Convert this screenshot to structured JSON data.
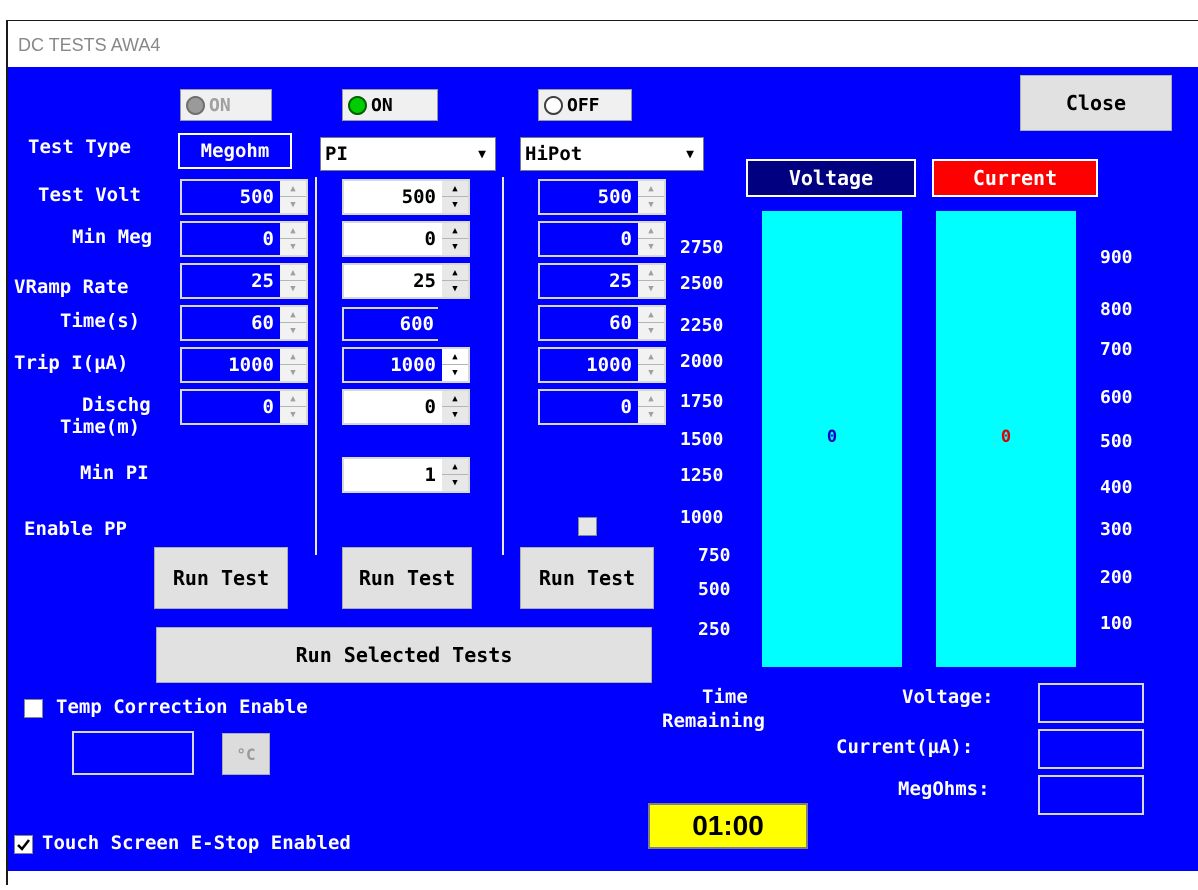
{
  "window": {
    "title": "DC TESTS  AWA4"
  },
  "colors": {
    "background": "#0000ff",
    "bar": "#00ffff",
    "on_led": "#00cc00",
    "current_header": "#ff0000",
    "voltage_header": "#000080",
    "timer_bg": "#ffff00"
  },
  "close_label": "Close",
  "row_labels": {
    "test_type": "Test Type",
    "test_volt": "Test Volt",
    "min_meg": "Min Meg",
    "vramp_rate": "VRamp Rate",
    "time_s": "Time(s)",
    "trip_i": "Trip I(µA)",
    "dischg_line1": "Dischg",
    "dischg_line2": "Time(m)",
    "min_pi": "Min PI",
    "enable_pp": "Enable PP"
  },
  "columns": [
    {
      "toggle": "ON",
      "toggle_state": "disabled",
      "type": "Megohm",
      "test_volt": "500",
      "min_meg": "0",
      "vramp_rate": "25",
      "time_s": "60",
      "trip_i": "1000",
      "dischg_time": "0",
      "run_label": "Run Test"
    },
    {
      "toggle": "ON",
      "toggle_state": "on",
      "type": "PI",
      "test_volt": "500",
      "min_meg": "0",
      "vramp_rate": "25",
      "time_s": "600",
      "trip_i": "1000",
      "dischg_time": "0",
      "min_pi": "1",
      "run_label": "Run Test"
    },
    {
      "toggle": "OFF",
      "toggle_state": "off",
      "type": "HiPot",
      "test_volt": "500",
      "min_meg": "0",
      "vramp_rate": "25",
      "time_s": "60",
      "trip_i": "1000",
      "dischg_time": "0",
      "run_label": "Run Test"
    }
  ],
  "run_selected_label": "Run Selected Tests",
  "temp_correction": {
    "label": "Temp Correction Enable",
    "checked": false,
    "unit_button": "°C"
  },
  "estop": {
    "label": "Touch Screen E-Stop Enabled",
    "checked": true
  },
  "meters": {
    "voltage_header": "Voltage",
    "current_header": "Current",
    "voltage_value": "0",
    "current_value": "0",
    "voltage_scale": [
      "2750",
      "2500",
      "2250",
      "2000",
      "1750",
      "1500",
      "1250",
      "1000",
      "750",
      "500",
      "250"
    ],
    "current_scale": [
      "900",
      "800",
      "700",
      "600",
      "500",
      "400",
      "300",
      "200",
      "100"
    ]
  },
  "time_remaining": {
    "label_line1": "Time",
    "label_line2": "Remaining",
    "value": "01:00"
  },
  "readouts": {
    "voltage_label": "Voltage:",
    "current_label": "Current(µA):",
    "megohms_label": "MegOhms:"
  }
}
